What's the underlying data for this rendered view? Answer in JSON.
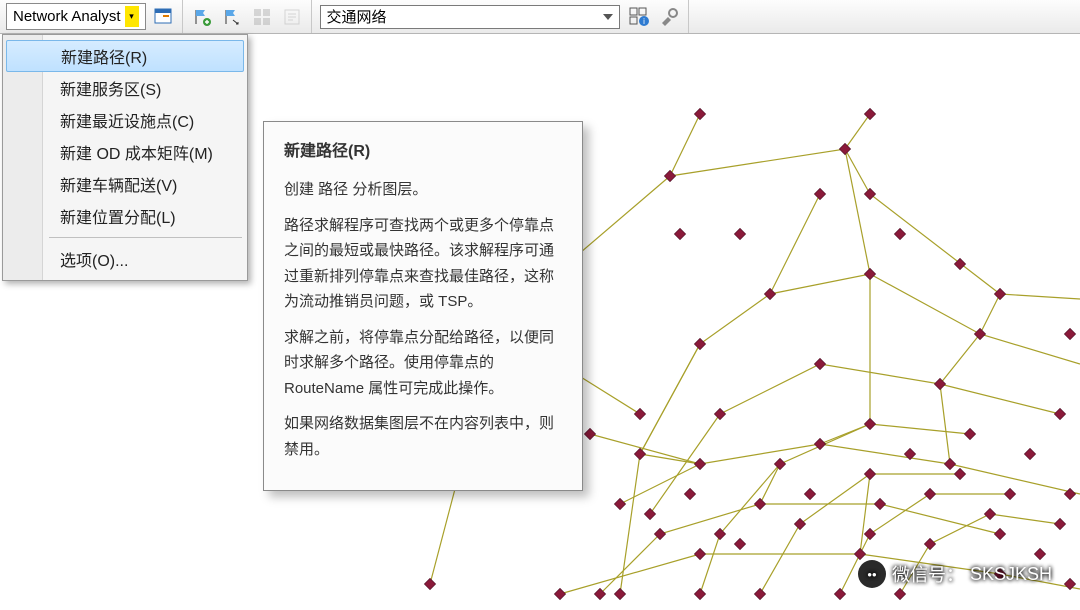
{
  "toolbar": {
    "na_label": "Network Analyst",
    "combo_value": "交通网络"
  },
  "menu": {
    "items": [
      {
        "label": "新建路径(R)",
        "selected": true
      },
      {
        "label": "新建服务区(S)"
      },
      {
        "label": "新建最近设施点(C)"
      },
      {
        "label": "新建 OD 成本矩阵(M)"
      },
      {
        "label": "新建车辆配送(V)"
      },
      {
        "label": "新建位置分配(L)"
      }
    ],
    "options_label": "选项(O)..."
  },
  "tooltip": {
    "title": "新建路径(R)",
    "p1": "创建 路径 分析图层。",
    "p2": "路径求解程序可查找两个或更多个停靠点之间的最短或最快路径。该求解程序可通过重新排列停靠点来查找最佳路径，这称为流动推销员问题，或 TSP。",
    "p3": "求解之前，将停靠点分配给路径，以便同时求解多个路径。使用停靠点的 RouteName 属性可完成此操作。",
    "p4": "如果网络数据集图层不在内容列表中，则禁用。"
  },
  "watermark": {
    "label": "微信号：",
    "id": "SKSJKSH"
  }
}
